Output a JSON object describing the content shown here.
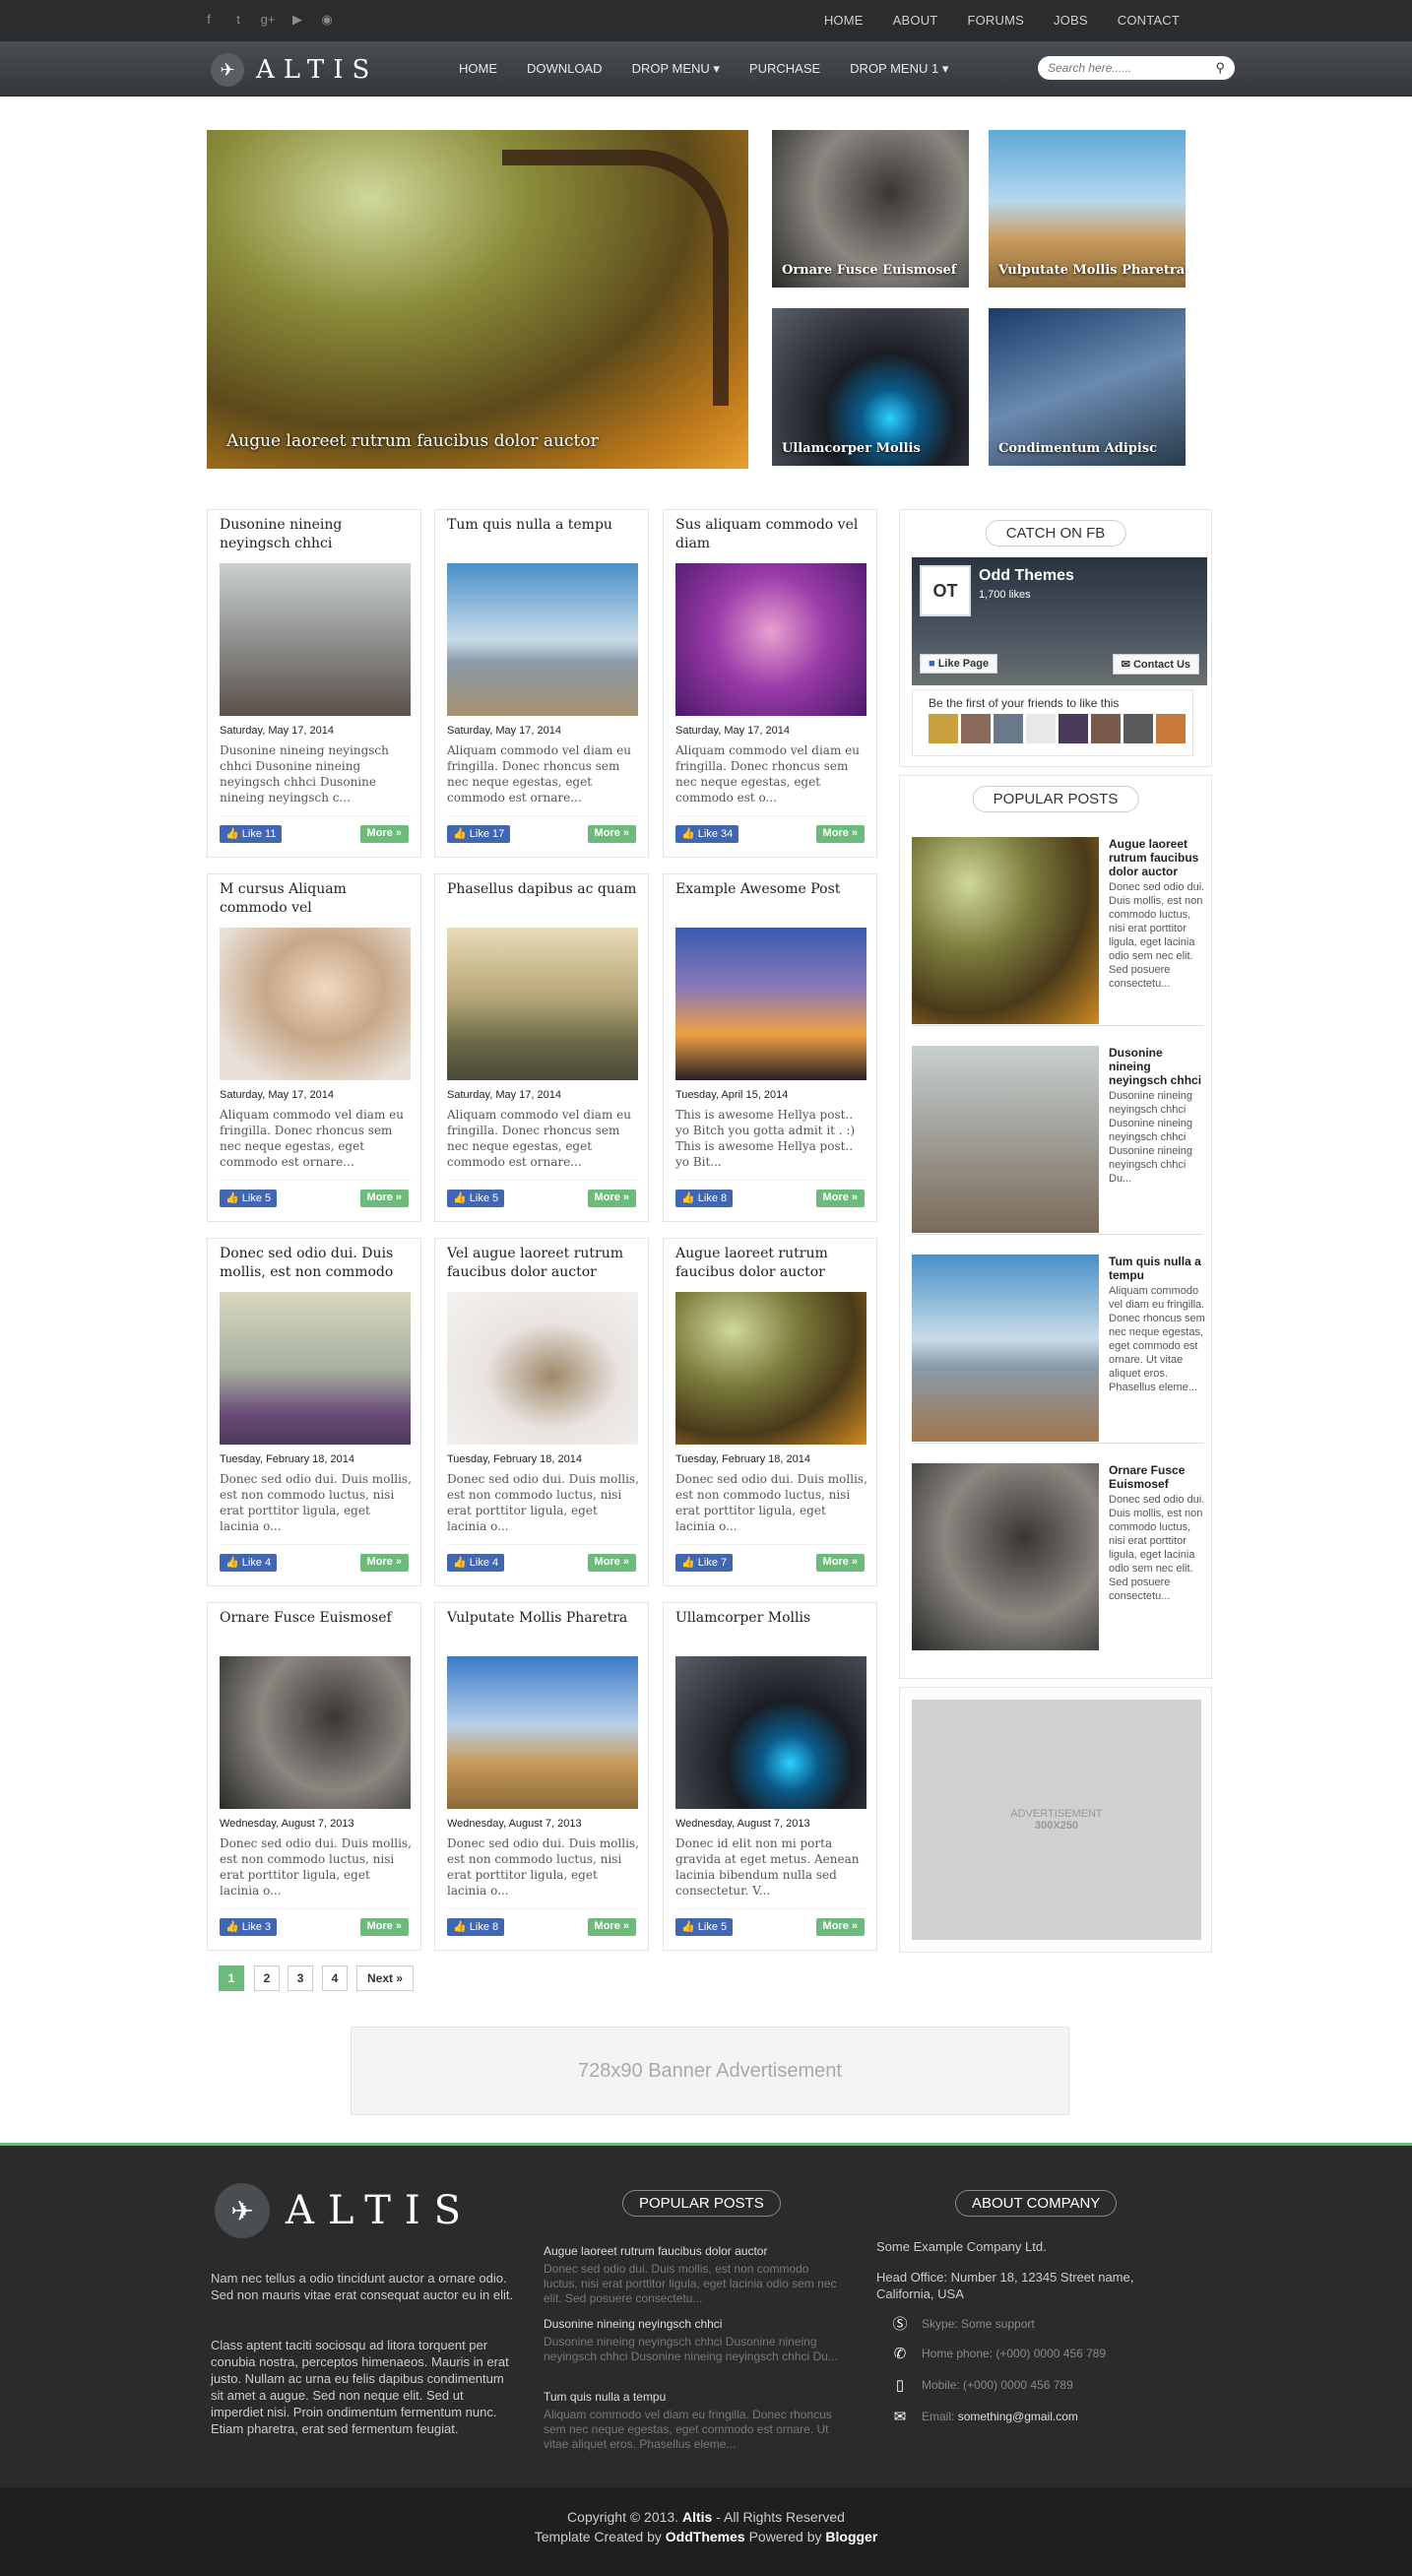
{
  "topnav": [
    "HOME",
    "ABOUT",
    "FORUMS",
    "JOBS",
    "CONTACT"
  ],
  "social_icons": [
    "facebook-icon",
    "twitter-icon",
    "google-plus-icon",
    "youtube-icon",
    "rss-icon"
  ],
  "brand": {
    "name": "ALTIS"
  },
  "mainnav": [
    {
      "label": "HOME"
    },
    {
      "label": "DOWNLOAD"
    },
    {
      "label": "DROP MENU ▾"
    },
    {
      "label": "PURCHASE"
    },
    {
      "label": "DROP MENU 1 ▾"
    }
  ],
  "search": {
    "placeholder": "Search here......"
  },
  "featured": {
    "main": "Augue laoreet rutrum faucibus dolor auctor",
    "small": [
      "Ornare Fusce Euismosef",
      "Vulputate Mollis Pharetra",
      "Ullamcorper Mollis",
      "Condimentum Adipisc"
    ]
  },
  "posts": [
    {
      "title": "Dusonine nineing neyingsch chhci",
      "date": "Saturday, May 17, 2014",
      "excerpt": "Dusonine nineing neyingsch chhci Dusonine nineing neyingsch chhci Dusonine nineing neyingsch c...",
      "likes": "Like 11",
      "more": "More »"
    },
    {
      "title": "Tum quis nulla a tempu",
      "date": "Saturday, May 17, 2014",
      "excerpt": "Aliquam commodo vel diam eu fringilla. Donec rhoncus sem nec neque egestas, eget commodo est ornare...",
      "likes": "Like 17",
      "more": "More »"
    },
    {
      "title": "Sus aliquam commodo vel diam",
      "date": "Saturday, May 17, 2014",
      "excerpt": "Aliquam commodo vel diam eu fringilla. Donec rhoncus sem nec neque egestas, eget commodo est o...",
      "likes": "Like 34",
      "more": "More »"
    },
    {
      "title": "M cursus Aliquam commodo vel",
      "date": "Saturday, May 17, 2014",
      "excerpt": "Aliquam commodo vel diam eu fringilla. Donec rhoncus sem nec neque egestas, eget commodo est ornare...",
      "likes": "Like 5",
      "more": "More »"
    },
    {
      "title": "Phasellus dapibus ac quam",
      "date": "Saturday, May 17, 2014",
      "excerpt": "Aliquam commodo vel diam eu fringilla. Donec rhoncus sem nec neque egestas, eget commodo est ornare...",
      "likes": "Like 5",
      "more": "More »"
    },
    {
      "title": "Example Awesome Post",
      "date": "Tuesday, April 15, 2014",
      "excerpt": "This is awesome Hellya post.. yo Bitch you gotta admit it . :) This is awesome Hellya post.. yo Bit...",
      "likes": "Like 8",
      "more": "More »"
    },
    {
      "title": "Donec sed odio dui. Duis mollis, est non commodo",
      "date": "Tuesday, February 18, 2014",
      "excerpt": "Donec sed odio dui. Duis mollis, est non commodo luctus, nisi erat porttitor ligula, eget lacinia o...",
      "likes": "Like 4",
      "more": "More »"
    },
    {
      "title": "Vel augue laoreet rutrum faucibus dolor auctor",
      "date": "Tuesday, February 18, 2014",
      "excerpt": "Donec sed odio dui. Duis mollis, est non commodo luctus, nisi erat porttitor ligula, eget lacinia o...",
      "likes": "Like 4",
      "more": "More »"
    },
    {
      "title": "Augue laoreet rutrum faucibus dolor auctor",
      "date": "Tuesday, February 18, 2014",
      "excerpt": "Donec sed odio dui. Duis mollis, est non commodo luctus, nisi erat porttitor ligula, eget lacinia o...",
      "likes": "Like 7",
      "more": "More »"
    },
    {
      "title": "Ornare Fusce Euismosef",
      "date": "Wednesday, August 7, 2013",
      "excerpt": "Donec sed odio dui. Duis mollis, est non commodo luctus, nisi erat porttitor ligula, eget lacinia o...",
      "likes": "Like 3",
      "more": "More »"
    },
    {
      "title": "Vulputate Mollis Pharetra",
      "date": "Wednesday, August 7, 2013",
      "excerpt": "Donec sed odio dui. Duis mollis, est non commodo luctus, nisi erat porttitor ligula, eget lacinia o...",
      "likes": "Like 8",
      "more": "More »"
    },
    {
      "title": "Ullamcorper Mollis",
      "date": "Wednesday, August 7, 2013",
      "excerpt": "Donec id elit non mi porta gravida at eget metus. Aenean lacinia bibendum nulla sed consectetur. V...",
      "likes": "Like 5",
      "more": "More »"
    }
  ],
  "pagination": [
    "1",
    "2",
    "3",
    "4",
    "Next »"
  ],
  "banner": "728x90 Banner Advertisement",
  "sidebar": {
    "fb": {
      "title": "CATCH ON FB",
      "page": "Odd Themes",
      "likes": "1,700 likes",
      "like_btn": "Like Page",
      "contact_btn": "Contact Us",
      "friends": "Be the first of your friends to like this"
    },
    "popular": {
      "title": "POPULAR POSTS",
      "items": [
        {
          "title": "Augue laoreet rutrum faucibus dolor auctor",
          "excerpt": "Donec sed odio dui. Duis mollis, est non commodo luctus, nisi erat porttitor ligula, eget lacinia odio sem nec elit. Sed posuere consectetu..."
        },
        {
          "title": "Dusonine nineing neyingsch chhci",
          "excerpt": "Dusonine nineing neyingsch chhci Dusonine nineing neyingsch chhci Dusonine nineing neyingsch chhci Du..."
        },
        {
          "title": "Tum quis nulla a tempu",
          "excerpt": "Aliquam commodo vel diam eu fringilla. Donec rhoncus sem nec neque egestas, eget commodo est ornare. Ut vitae aliquet eros. Phasellus eleme..."
        },
        {
          "title": "Ornare Fusce Euismosef",
          "excerpt": "Donec sed odio dui. Duis mollis, est non commodo luctus, nisi erat porttitor ligula, eget lacinia odio sem nec elit. Sed posuere consectetu..."
        }
      ]
    },
    "ad": {
      "line1": "ADVERTISEMENT",
      "line2": "300X250"
    }
  },
  "footer": {
    "about_1": "Nam nec tellus a odio tincidunt auctor a ornare odio. Sed non mauris vitae erat consequat auctor eu in elit.",
    "about_2": "Class aptent taciti sociosqu ad litora torquent per conubia nostra, perceptos himenaeos. Mauris in erat justo. Nullam ac urna eu felis dapibus condimentum sit amet a augue. Sed non neque elit. Sed ut imperdiet nisi. Proin ondimentum fermentum nunc. Etiam pharetra, erat sed fermentum feugiat.",
    "popular_title": "POPULAR POSTS",
    "popular": [
      {
        "title": "Augue laoreet rutrum faucibus dolor auctor",
        "excerpt": "Donec sed odio dui. Duis mollis, est non commodo luctus, nisi erat porttitor ligula, eget lacinia odio sem nec elit. Sed posuere consectetu..."
      },
      {
        "title": "Dusonine nineing neyingsch chhci",
        "excerpt": "Dusonine nineing neyingsch chhci Dusonine nineing neyingsch chhci Dusonine nineing neyingsch chhci Du..."
      },
      {
        "title": "Tum quis nulla a tempu",
        "excerpt": "Aliquam commodo vel diam eu fringilla. Donec rhoncus sem nec neque egestas, eget commodo est ornare. Ut vitae aliquet eros. Phasellus eleme..."
      }
    ],
    "company_title": "ABOUT COMPANY",
    "company_name": "Some Example Company Ltd.",
    "office": "Head Office: Number 18, 12345 Street name, California, USA",
    "skype": "Skype: Some support",
    "home": "Home phone: (+000) 0000 456 789",
    "mobile": "Mobile: (+000) 0000 456 789",
    "email_label": "Email: ",
    "email": "something@gmail.com",
    "copy_1": "Copyright © 2013. ",
    "copy_brand": "Altis",
    "copy_2": " - All Rights Reserved",
    "credit_1": "Template Created by ",
    "credit_author": "OddThemes",
    "credit_2": " Powered by ",
    "credit_platform": "Blogger"
  }
}
